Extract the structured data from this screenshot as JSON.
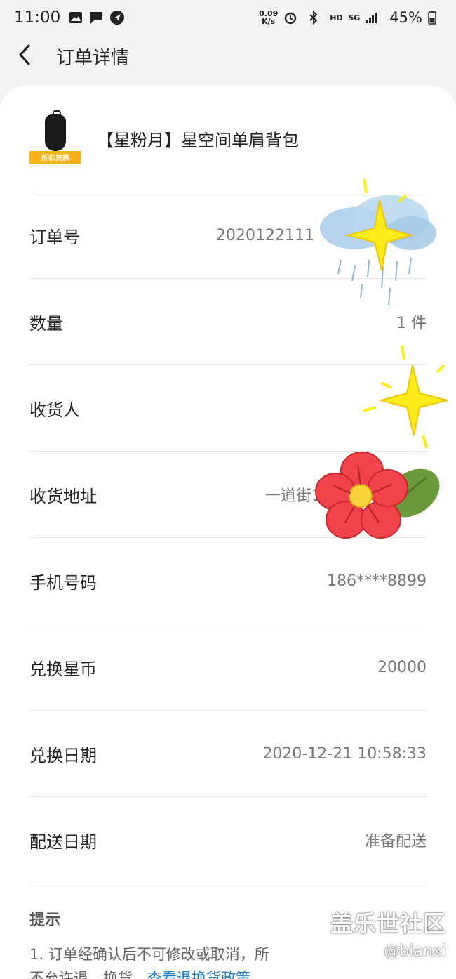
{
  "status_bar": {
    "time": "11:00",
    "net_speed_value": "0.09",
    "net_speed_unit": "K/s",
    "hd": "HD",
    "network": "5G",
    "battery": "45%",
    "icons": [
      "image-icon",
      "message-icon",
      "app-icon",
      "alarm-icon",
      "bluetooth-icon",
      "signal-icon",
      "battery-icon"
    ]
  },
  "app_bar": {
    "title": "订单详情",
    "back_icon": "chevron-left-icon"
  },
  "product": {
    "name": "【星粉月】星空间单肩背包",
    "tag": "折扣兑换"
  },
  "rows": [
    {
      "label": "订单号",
      "value": "2020122111"
    },
    {
      "label": "数量",
      "value": "1 件"
    },
    {
      "label": "收货人",
      "value": ""
    },
    {
      "label": "收货地址",
      "value": "一道街1"
    },
    {
      "label": "手机号码",
      "value": "186****8899"
    },
    {
      "label": "兑换星币",
      "value": "20000"
    },
    {
      "label": "兑换日期",
      "value": "2020-12-21 10:58:33"
    },
    {
      "label": "配送日期",
      "value": "准备配送"
    }
  ],
  "tips": {
    "title": "提示",
    "line1": "1. 订单经确认后不可修改或取消，所",
    "line2_prefix": "不允许退、换货。",
    "line2_link1": "查看退",
    "line2_link2": "换货政策"
  },
  "watermark": {
    "title": "盖乐世社区",
    "user": "@bianxi"
  },
  "colors": {
    "background": "#f3f3f3",
    "card": "#ffffff",
    "link": "#1e7fc4",
    "tag": "#f6b21c"
  }
}
